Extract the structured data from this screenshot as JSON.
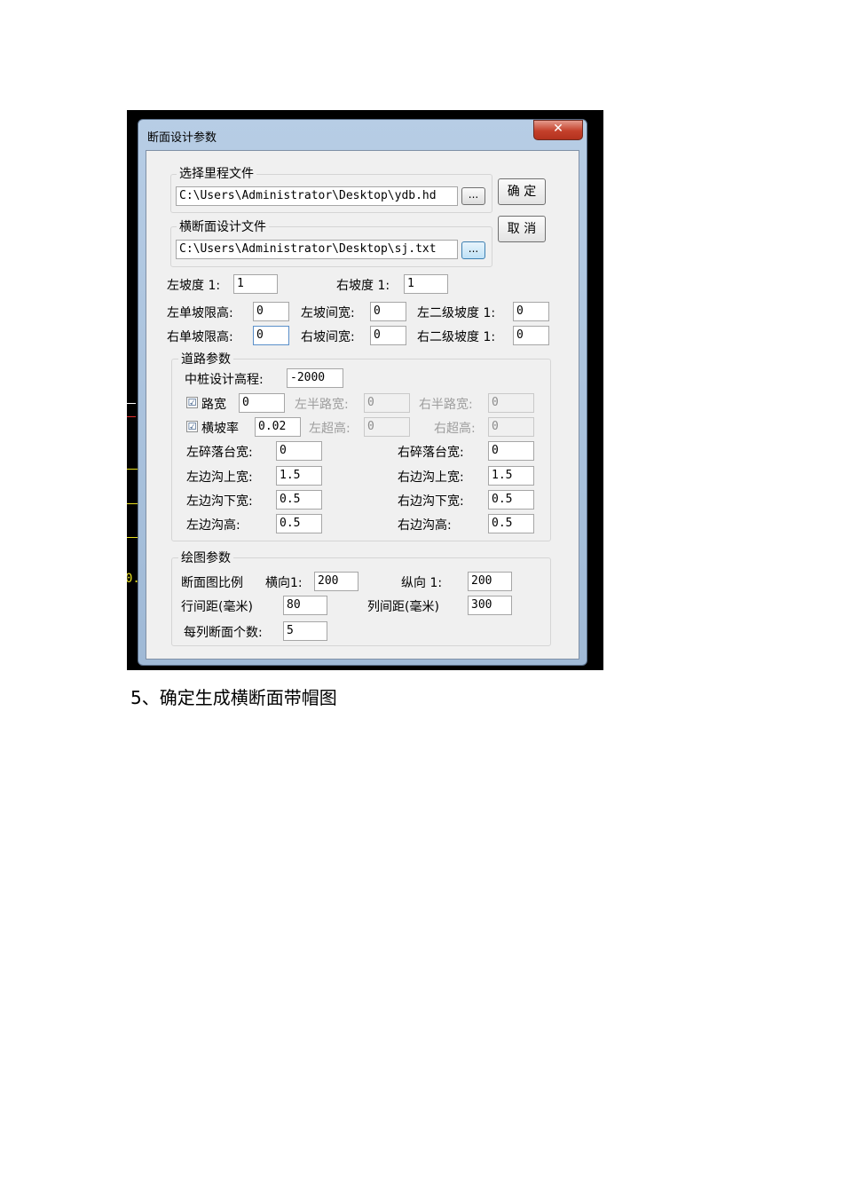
{
  "caption": "5、确定生成横断面带帽图",
  "background_cad": {
    "partial_text": "0.",
    "line_colors": [
      "#ffffff",
      "#e8e020",
      "#e03030"
    ]
  },
  "window": {
    "title": "断面设计参数",
    "close_glyph": "✕"
  },
  "mileage_file": {
    "legend": "选择里程文件",
    "value": "C:\\Users\\Administrator\\Desktop\\ydb.hd",
    "browse": "..."
  },
  "section_file": {
    "legend": "横断面设计文件",
    "value": "C:\\Users\\Administrator\\Desktop\\sj.txt",
    "browse": "..."
  },
  "buttons": {
    "ok": "确 定",
    "cancel": "取 消"
  },
  "slopes": {
    "left_label": "左坡度 1:",
    "left_value": "1",
    "right_label": "右坡度 1:",
    "right_value": "1"
  },
  "limits": {
    "left_single_label": "左单坡限高:",
    "left_single_value": "0",
    "left_interval_label": "左坡间宽:",
    "left_interval_value": "0",
    "left_second_label": "左二级坡度 1:",
    "left_second_value": "0",
    "right_single_label": "右单坡限高:",
    "right_single_value": "0",
    "right_interval_label": "右坡间宽:",
    "right_interval_value": "0",
    "right_second_label": "右二级坡度 1:",
    "right_second_value": "0"
  },
  "road": {
    "legend": "道路参数",
    "center_label": "中桩设计高程:",
    "center_value": "-2000",
    "width_check": "☑",
    "width_label": "路宽",
    "width_value": "0",
    "left_half_label": "左半路宽:",
    "left_half_value": "0",
    "right_half_label": "右半路宽:",
    "right_half_value": "0",
    "slope_check": "☑",
    "slope_label": "横坡率",
    "slope_value": "0.02",
    "left_super_label": "左超高:",
    "left_super_value": "0",
    "right_super_label": "右超高:",
    "right_super_value": "0",
    "left_berm_label": "左碎落台宽:",
    "left_berm_value": "0",
    "right_berm_label": "右碎落台宽:",
    "right_berm_value": "0",
    "left_ditch_top_label": "左边沟上宽:",
    "left_ditch_top_value": "1.5",
    "right_ditch_top_label": "右边沟上宽:",
    "right_ditch_top_value": "1.5",
    "left_ditch_bottom_label": "左边沟下宽:",
    "left_ditch_bottom_value": "0.5",
    "right_ditch_bottom_label": "右边沟下宽:",
    "right_ditch_bottom_value": "0.5",
    "left_ditch_height_label": "左边沟高:",
    "left_ditch_height_value": "0.5",
    "right_ditch_height_label": "右边沟高:",
    "right_ditch_height_value": "0.5"
  },
  "drawing": {
    "legend": "绘图参数",
    "scale_label": "断面图比例",
    "horizontal_label": "横向1:",
    "horizontal_value": "200",
    "vertical_label": "纵向 1:",
    "vertical_value": "200",
    "row_spacing_label": "行间距(毫米)",
    "row_spacing_value": "80",
    "col_spacing_label": "列间距(毫米)",
    "col_spacing_value": "300",
    "per_column_label": "每列断面个数:",
    "per_column_value": "5"
  }
}
